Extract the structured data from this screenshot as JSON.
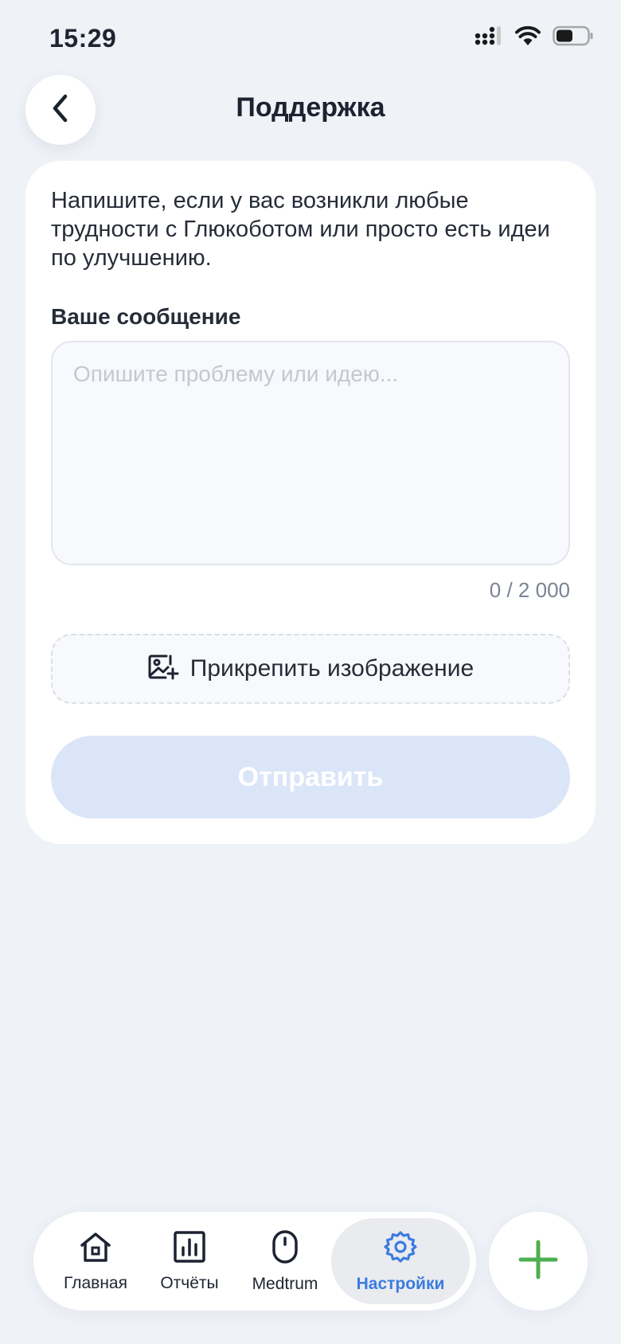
{
  "status_bar": {
    "time": "15:29",
    "icons": [
      "cellular-signal-icon",
      "wifi-icon",
      "battery-icon"
    ]
  },
  "header": {
    "back_icon": "chevron-left-icon",
    "title": "Поддержка"
  },
  "form": {
    "intro": "Напишите, если у вас возникли любые трудности с Глюкоботом или просто есть идеи по улучшению.",
    "message_label": "Ваше сообщение",
    "message_value": "",
    "message_placeholder": "Опишите проблему или идею...",
    "char_counter": "0 / 2 000",
    "attach_icon": "image-add-icon",
    "attach_label": "Прикрепить изображение",
    "send_label": "Отправить",
    "send_enabled": false
  },
  "tab_bar": {
    "tabs": [
      {
        "label": "Главная",
        "icon": "home-icon",
        "active": false
      },
      {
        "label": "Отчёты",
        "icon": "bar-chart-icon",
        "active": false
      },
      {
        "label": "Medtrum",
        "icon": "device-icon",
        "active": false
      },
      {
        "label": "Настройки",
        "icon": "gear-icon",
        "active": true
      }
    ]
  },
  "fab": {
    "icon": "plus-icon"
  },
  "colors": {
    "background": "#eff2f7",
    "card": "#ffffff",
    "accent": "#3b7be0",
    "send_disabled": "#dbe5f8",
    "plus": "#4caf50"
  }
}
